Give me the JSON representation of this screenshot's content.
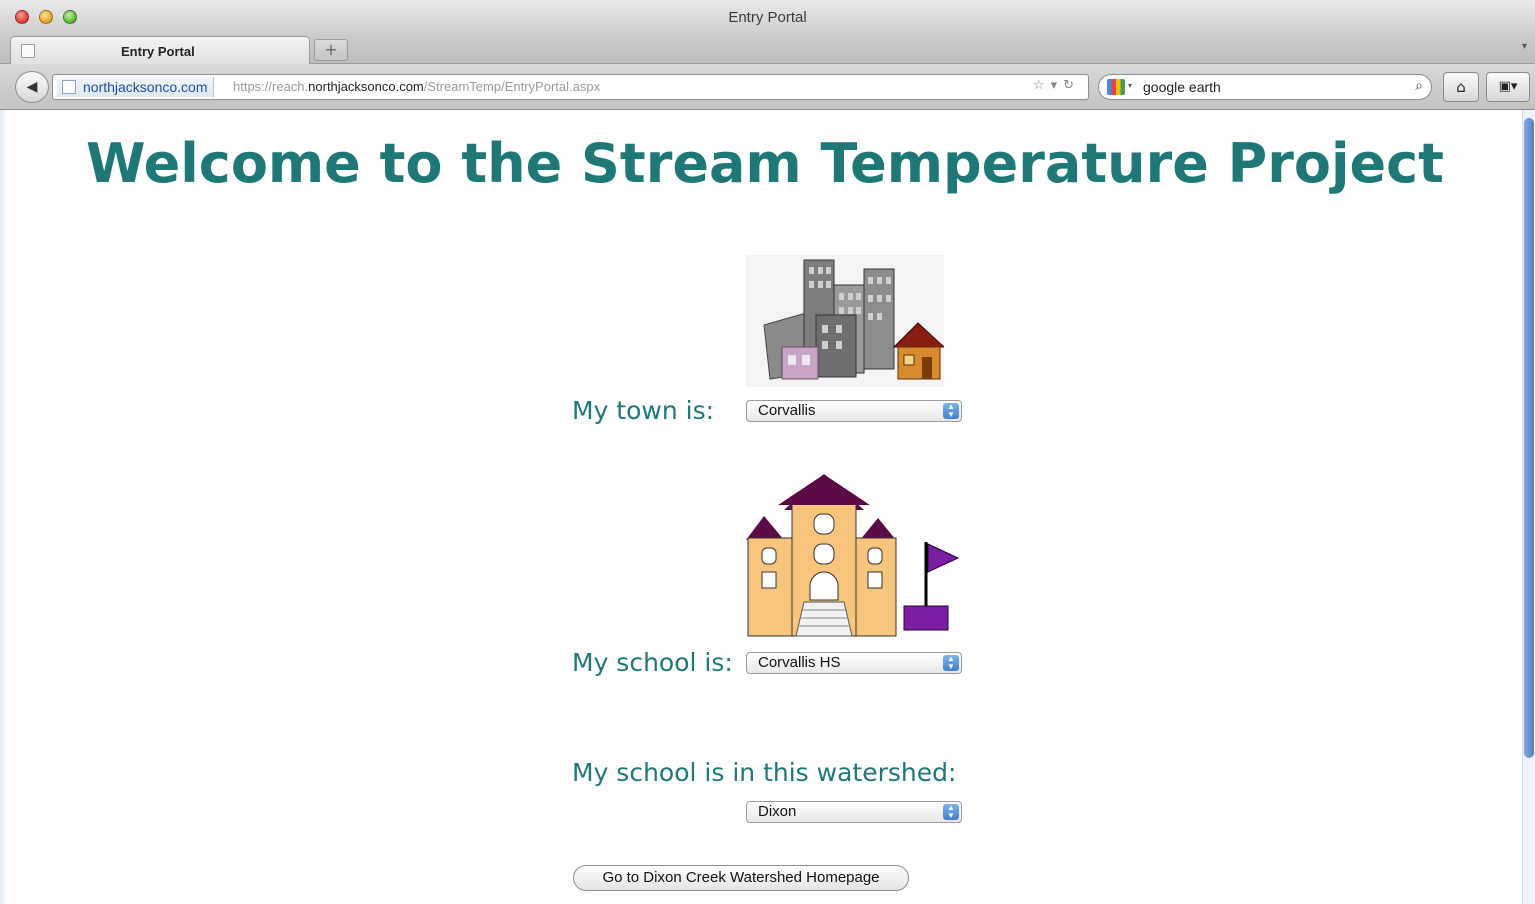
{
  "window": {
    "title": "Entry Portal"
  },
  "tabs": [
    {
      "label": "Entry Portal"
    }
  ],
  "navbar": {
    "site_identity": "northjacksonco.com",
    "url_prefix": "https://reach.",
    "url_host": "northjacksonco.com",
    "url_path": "/StreamTemp/EntryPortal.aspx",
    "search_query": "google earth"
  },
  "page": {
    "heading": "Welcome to the Stream Temperature Project",
    "town": {
      "label": "My town is:",
      "selected": "Corvallis"
    },
    "school": {
      "label": "My school is:",
      "selected": "Corvallis HS"
    },
    "watershed": {
      "label": "My school is in this watershed:",
      "selected": "Dixon"
    },
    "go_button": "Go to Dixon Creek Watershed Homepage"
  },
  "colors": {
    "heading": "#1d7877",
    "school_walls": "#f7c57b",
    "school_roof": "#5c0a47",
    "flag": "#7a1fa3",
    "house_roof": "#8a1c12"
  },
  "icons": [
    "back-arrow-icon",
    "bookmark-star-icon",
    "reload-icon",
    "search-icon",
    "home-icon",
    "tools-icon",
    "dropdown-arrows-icon"
  ]
}
